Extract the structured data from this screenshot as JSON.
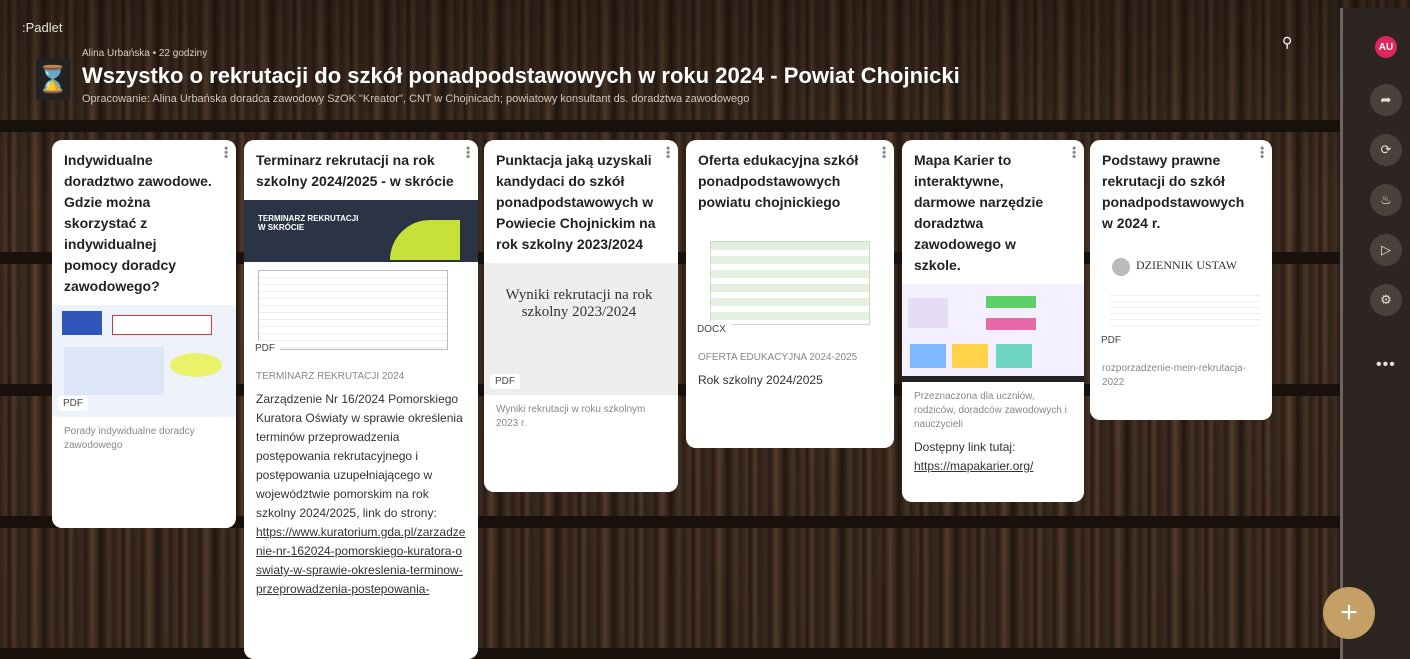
{
  "app": {
    "brand": ":Padlet"
  },
  "header": {
    "icon": "hourglass-icon",
    "meta": "Alina Urbańska • 22 godziny",
    "title": "Wszystko o rekrutacji do szkół ponadpodstawowych w roku 2024 - Powiat Chojnicki",
    "subtitle": "Opracowanie: Alina Urbańska doradca zawodowy SzOK \"Kreator\", CNT w Chojnicach; powiatowy konsultant ds. doradztwa zawodowego"
  },
  "toolbar": {
    "search_icon": "search-icon",
    "avatar": "AU",
    "buttons": [
      "share-icon",
      "remix-icon",
      "bell-icon",
      "slideshow-icon",
      "settings-icon"
    ],
    "more": "•••"
  },
  "fab": {
    "label": "+"
  },
  "cards": [
    {
      "title": "Indywidualne doradztwo zawodowe. Gdzie można skorzystać z indywidualnej pomocy doradcy zawodowego?",
      "badge": "PDF",
      "caption": "Porady indywidualne doradcy zawodowego"
    },
    {
      "title": "Terminarz rekrutacji na rok szkolny 2024/2025 - w skrócie",
      "thumb_title": "TERMINARZ REKRUTACJI W SKRÓCIE",
      "badge": "PDF",
      "caption": "TERMINARZ REKRUTACJI 2024",
      "body": "Zarządzenie Nr 16/2024 Pomorskiego Kuratora Oświaty w sprawie określenia terminów przeprowadzenia postępowania rekrutacyjnego i postępowania uzupełniającego w województwie pomorskim na rok szkolny 2024/2025, link do strony:",
      "link": "https://www.kuratorium.gda.pl/zarzadzenie-nr-162024-pomorskiego-kuratora-oswiaty-w-sprawie-okreslenia-terminow-przeprowadzenia-postepowania-"
    },
    {
      "title": "Punktacja jaką uzyskali kandydaci do szkół ponadpodstawowych w Powiecie Chojnickim na rok szkolny 2023/2024",
      "thumb_title": "Wyniki rekrutacji na rok szkolny 2023/2024",
      "badge": "PDF",
      "caption": "Wyniki rekrutacji w roku szkolnym 2023 r."
    },
    {
      "title": "Oferta edukacyjna szkół ponadpodstawowych powiatu chojnickiego",
      "badge": "DOCX",
      "caption": "OFERTA EDUKACYJNA 2024-2025",
      "body": "Rok szkolny 2024/2025"
    },
    {
      "title": "Mapa Karier to interaktywne, darmowe narzędzie doradztwa zawodowego w szkole.",
      "caption": "Przeznaczona dla uczniów, rodziców, doradców zawodowych i nauczycieli",
      "body": "Dostępny link tutaj:",
      "link": "https://mapakarier.org/"
    },
    {
      "title": "Podstawy prawne rekrutacji do szkół ponadpodstawowych w 2024 r.",
      "thumb_title": "DZIENNIK USTAW",
      "badge": "PDF",
      "caption": "rozporzadzenie-mein-rekrutacja-2022"
    }
  ]
}
